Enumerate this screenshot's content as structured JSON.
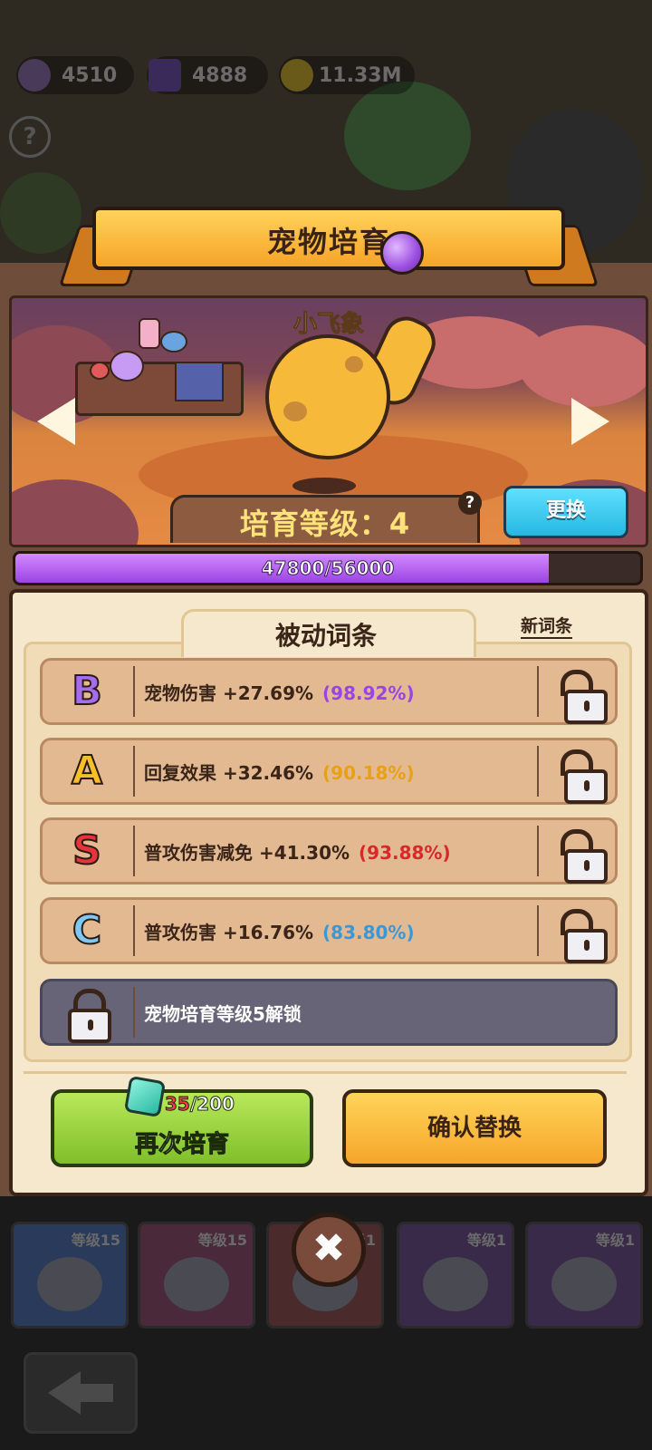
{
  "currencies": [
    {
      "icon": "purple-potion-icon",
      "value": "4510"
    },
    {
      "icon": "purple-cube-icon",
      "value": "4888"
    },
    {
      "icon": "gold-coin-icon",
      "value": "11.33M"
    }
  ],
  "help_glyph": "?",
  "dialog": {
    "title": "宠物培育",
    "pet_name": "小飞象",
    "level_label": "培育等级：4",
    "change_button": "更换",
    "progress": {
      "current": 47800,
      "max": 56000,
      "text": "47800/56000"
    }
  },
  "affix_panel": {
    "tab_label": "被动词条",
    "new_affix_link": "新词条",
    "rows": [
      {
        "grade": "B",
        "grade_color": "#a66cf0",
        "text": "宠物伤害 +27.69%",
        "pct": "(98.92%)",
        "pct_color": "#9b44e4"
      },
      {
        "grade": "A",
        "grade_color": "#f7c02a",
        "text": "回复效果 +32.46%",
        "pct": "(90.18%)",
        "pct_color": "#e8a016"
      },
      {
        "grade": "S",
        "grade_color": "#e8333a",
        "text": "普攻伤害减免 +41.30%",
        "pct": "(93.88%)",
        "pct_color": "#d62a2a"
      },
      {
        "grade": "C",
        "grade_color": "#7ec8f4",
        "text": "普攻伤害 +16.76%",
        "pct": "(83.80%)",
        "pct_color": "#3b98d4"
      }
    ],
    "locked_row": "宠物培育等级5解锁"
  },
  "actions": {
    "retrain": {
      "label": "再次培育",
      "cost_have": "35",
      "cost_total": "/200"
    },
    "confirm": "确认替换"
  },
  "pet_cards": [
    {
      "level": "等级15",
      "color": "#2a3a5a"
    },
    {
      "level": "等级15",
      "color": "#4a2a3a"
    },
    {
      "level": "等级1",
      "color": "#4a2a2a"
    },
    {
      "level": "等级1",
      "color": "#3a2a4a"
    },
    {
      "level": "等级1",
      "color": "#3a2a4a"
    }
  ],
  "close_glyph": "✖"
}
